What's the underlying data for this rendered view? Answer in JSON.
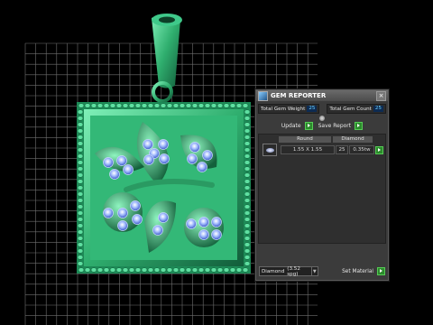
{
  "panel": {
    "title": "GEM REPORTER",
    "stats": {
      "weight_label": "Total Gem Weight",
      "weight_value": "25",
      "count_label": "Total Gem Count",
      "count_value": "25"
    },
    "actions": {
      "update_label": "Update",
      "save_label": "Save Report"
    },
    "table": {
      "headers": [
        "Round",
        "Diamond"
      ],
      "rows": [
        {
          "shape": "Round",
          "size": "1.55 X 1.55",
          "count": "25",
          "weight": "0.35tw",
          "material": "Diamond"
        }
      ]
    },
    "material": {
      "selected": "Diamond",
      "spg": "(3.52 spg)",
      "set_label": "Set Material"
    }
  },
  "viewport": {
    "colors": {
      "background": "#000000",
      "grid": "#6f6f6f",
      "metal": "#2fae6e",
      "gem": "#9fb8ff"
    },
    "icons": [
      "gem-reporter-logo-icon",
      "close-icon",
      "rotate-icon",
      "go-arrow-icon",
      "round-gem-icon",
      "dropdown-arrow-icon"
    ]
  }
}
